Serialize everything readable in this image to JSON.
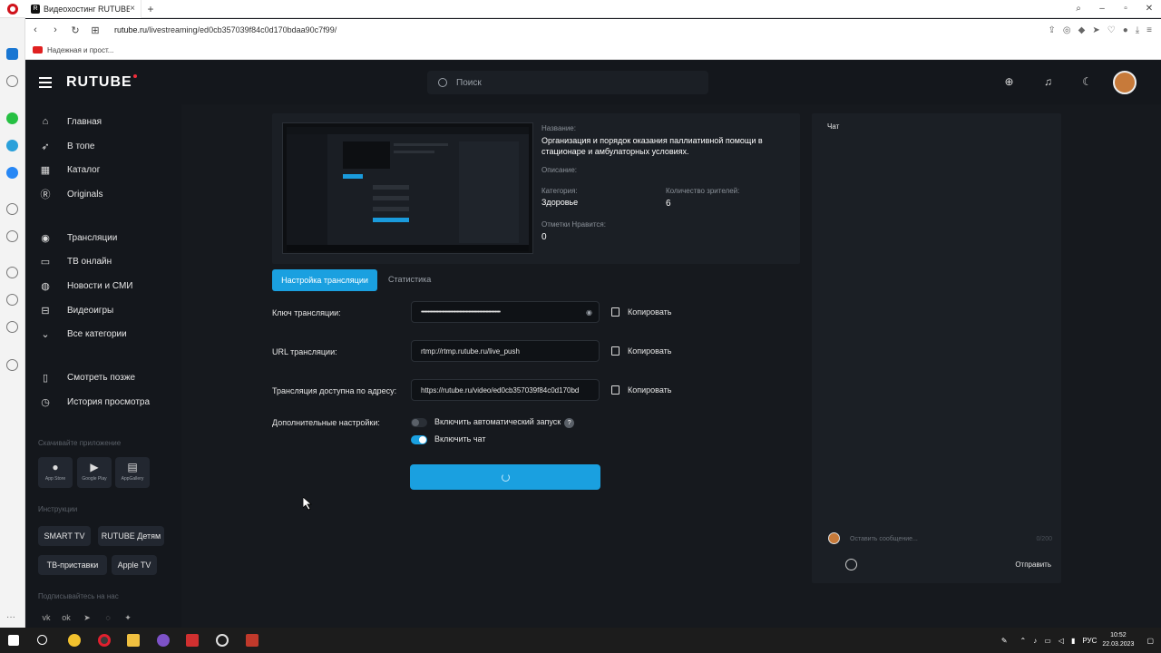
{
  "browser": {
    "tab_title": "Видеохостинг RUTUBE. Cм",
    "tab_close": "×",
    "new_tab": "+",
    "url_domain": "rutube.ru",
    "url_path": "/livestreaming/ed0cb357039f84c0d170bdaa90c7f99/",
    "bookmark": "Надежная и прост..."
  },
  "header": {
    "logo": "RUTUBE",
    "search_placeholder": "Поиск"
  },
  "nav": {
    "main": [
      "Главная",
      "В топе",
      "Каталог",
      "Originals"
    ],
    "broadcast": [
      "Трансляции",
      "ТВ онлайн",
      "Новости и СМИ",
      "Видеоигры",
      "Все категории"
    ],
    "personal": [
      "Смотреть позже",
      "История просмотра"
    ],
    "download_label": "Скачивайте приложение",
    "stores": [
      "App Store",
      "Google Play",
      "AppGallery"
    ],
    "instructions_label": "Инструкции",
    "instructions": [
      "SMART TV",
      "RUTUBE Детям",
      "ТВ-приставки",
      "Apple TV"
    ],
    "subscribe_label": "Подписывайтесь на нас"
  },
  "stream_info": {
    "name_label": "Название:",
    "name_value": "Организация и порядок оказания паллиативной помощи в стационаре и амбулаторных условиях.",
    "description_label": "Описание:",
    "category_label": "Категория:",
    "category_value": "Здоровье",
    "viewers_label": "Количество зрителей:",
    "viewers_value": "6",
    "likes_label": "Отметки Нравится:",
    "likes_value": "0"
  },
  "tabs": {
    "active": "Настройка трансляции",
    "inactive": "Статистика"
  },
  "settings": {
    "key_label": "Ключ трансляции:",
    "key_value": "••••••••••••••••••••••••••••••••••••••••••••••••••••••••••••",
    "url_label": "URL трансляции:",
    "url_value": "rtmp://rtmp.rutube.ru/live_push",
    "address_label": "Трансляция доступна по адресу:",
    "address_value": "https://rutube.ru/video/ed0cb357039f84c0d170bd",
    "copy_label": "Копировать",
    "extra_label": "Дополнительные настройки:",
    "autostart_label": "Включить автоматический запуск",
    "autostart_on": false,
    "chat_label": "Включить чат",
    "chat_on": true,
    "help": "?"
  },
  "chat": {
    "title": "Чат",
    "placeholder": "Оставить сообщение...",
    "counter": "0/200",
    "send": "Отправить"
  },
  "taskbar": {
    "lang": "РУС",
    "time": "10:52",
    "date": "22.03.2023"
  },
  "colors": {
    "accent": "#1aa0e0",
    "background": "#16191e",
    "panel": "#1b1f25"
  }
}
